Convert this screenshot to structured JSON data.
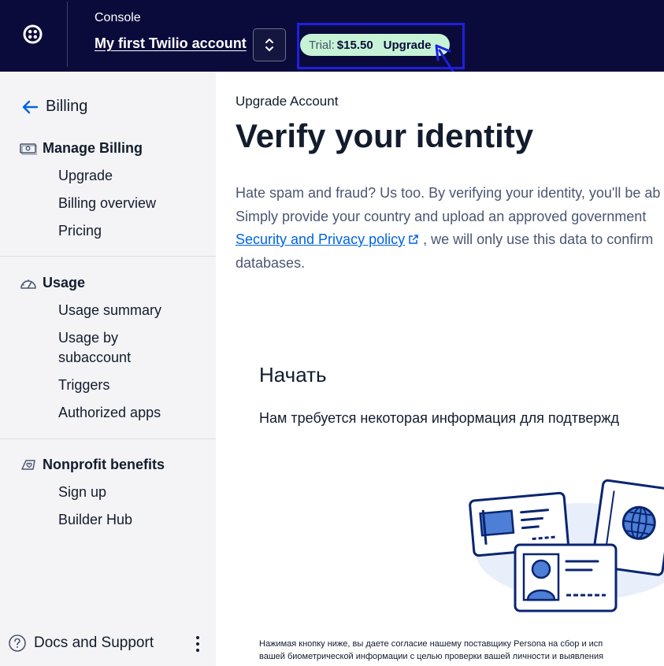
{
  "header": {
    "console_label": "Console",
    "account_name": "My first Twilio account",
    "trial_label": "Trial:",
    "trial_amount": "$15.50",
    "upgrade_label": "Upgrade",
    "colors": {
      "background": "#0b0b3b",
      "trial_pill": "#c6f3d6",
      "highlight": "#1f1fe0"
    }
  },
  "sidebar": {
    "back_label": "Billing",
    "sections": [
      {
        "title": "Manage Billing",
        "icon": "money-icon",
        "items": [
          "Upgrade",
          "Billing overview",
          "Pricing"
        ]
      },
      {
        "title": "Usage",
        "icon": "gauge-icon",
        "items": [
          "Usage summary",
          "Usage by subaccount",
          "Triggers",
          "Authorized apps"
        ]
      },
      {
        "title": "Nonprofit benefits",
        "icon": "heart-hand-icon",
        "items": [
          "Sign up",
          "Builder Hub"
        ]
      }
    ],
    "docs_label": "Docs and Support"
  },
  "main": {
    "eyebrow": "Upgrade Account",
    "title": "Verify your identity",
    "desc_line1": "Hate spam and fraud? Us too. By verifying your identity, you'll be ab",
    "desc_line2": "Simply provide your country and upload an approved government",
    "desc_link": "Security and Privacy policy",
    "desc_line3_rest": ", we will only use this data to confirm",
    "desc_line4": "databases.",
    "start_title": "Начать",
    "start_text": "Нам требуется некоторая информация для подтвержд",
    "legal_line1": "Нажимая кнопку ниже, вы даете согласие нашему поставщику Persona на сбор и исп",
    "legal_line2": "вашей биометрической информации с целью проверки вашей личности и выявления"
  }
}
